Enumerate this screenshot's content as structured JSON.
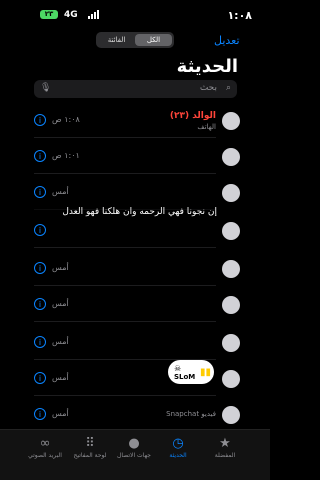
{
  "status": {
    "time": "١:٠٨",
    "network": "4G",
    "battery": "٢٣"
  },
  "header": {
    "edit": "تعديل",
    "segments": [
      "الكل",
      "الفائتة"
    ],
    "title": "الحديثة"
  },
  "search": {
    "placeholder": "بحث"
  },
  "calls": [
    {
      "name": "الوالد (٢٣)",
      "sub": "الهاتف",
      "time": "١:٠٨ ص",
      "missed": true
    },
    {
      "name": "",
      "sub": "",
      "time": "١:٠١ ص"
    },
    {
      "name": "",
      "sub": "",
      "time": "أمس"
    },
    {
      "name": "",
      "sub": "",
      "time": ""
    },
    {
      "name": "",
      "sub": "",
      "time": "أمس"
    },
    {
      "name": "",
      "sub": "",
      "time": "أمس"
    },
    {
      "name": "",
      "sub": "",
      "time": "أمس"
    },
    {
      "name": "",
      "sub": "",
      "time": "أمس"
    },
    {
      "name": "",
      "sub": "Snapchat فيديو",
      "time": "أمس"
    }
  ],
  "overlay": {
    "caption": "إن نجونا فهي الرحمه وان هلكنا فهو العدل",
    "badge": "SLoM"
  },
  "tabs": [
    {
      "label": "المفضلة",
      "icon": "★"
    },
    {
      "label": "الحديثة",
      "icon": "◷"
    },
    {
      "label": "جهات الاتصال",
      "icon": "●"
    },
    {
      "label": "لوحة المفاتيح",
      "icon": "⠿"
    },
    {
      "label": "البريد الصوتي",
      "icon": "∞"
    }
  ],
  "colors": {
    "accent": "#0a84ff",
    "missed": "#ff453a"
  }
}
